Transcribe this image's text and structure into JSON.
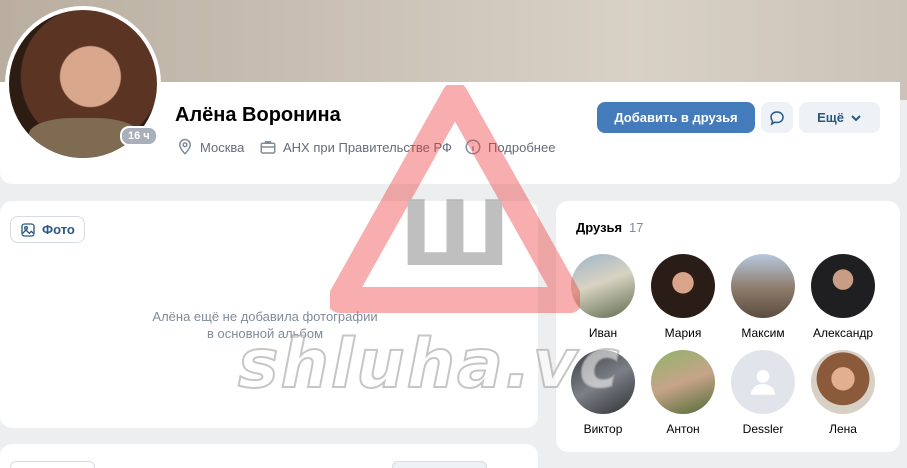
{
  "profile": {
    "name": "Алёна Воронина",
    "online_badge": "16 ч",
    "city": "Москва",
    "work": "АНХ при Правительстве РФ",
    "details_link": "Подробнее"
  },
  "actions": {
    "add_friend": "Добавить в друзья",
    "more": "Ещё"
  },
  "photos": {
    "tab_label": "Фото",
    "empty_line1": "Алёна ещё не добавила фотографии",
    "empty_line2": "в основной альбом"
  },
  "friends": {
    "title": "Друзья",
    "count": "17",
    "items": [
      {
        "name": "Иван"
      },
      {
        "name": "Мария"
      },
      {
        "name": "Максим"
      },
      {
        "name": "Александр"
      },
      {
        "name": "Виктор"
      },
      {
        "name": "Антон"
      },
      {
        "name": "Dessler"
      },
      {
        "name": "Лена"
      }
    ]
  },
  "watermark": {
    "letter": "Ш",
    "text": "shluha.vc"
  },
  "colors": {
    "accent": "#447bba",
    "link": "#2a5885",
    "background": "#edeef0",
    "watermark_red": "#ee3b3b"
  }
}
